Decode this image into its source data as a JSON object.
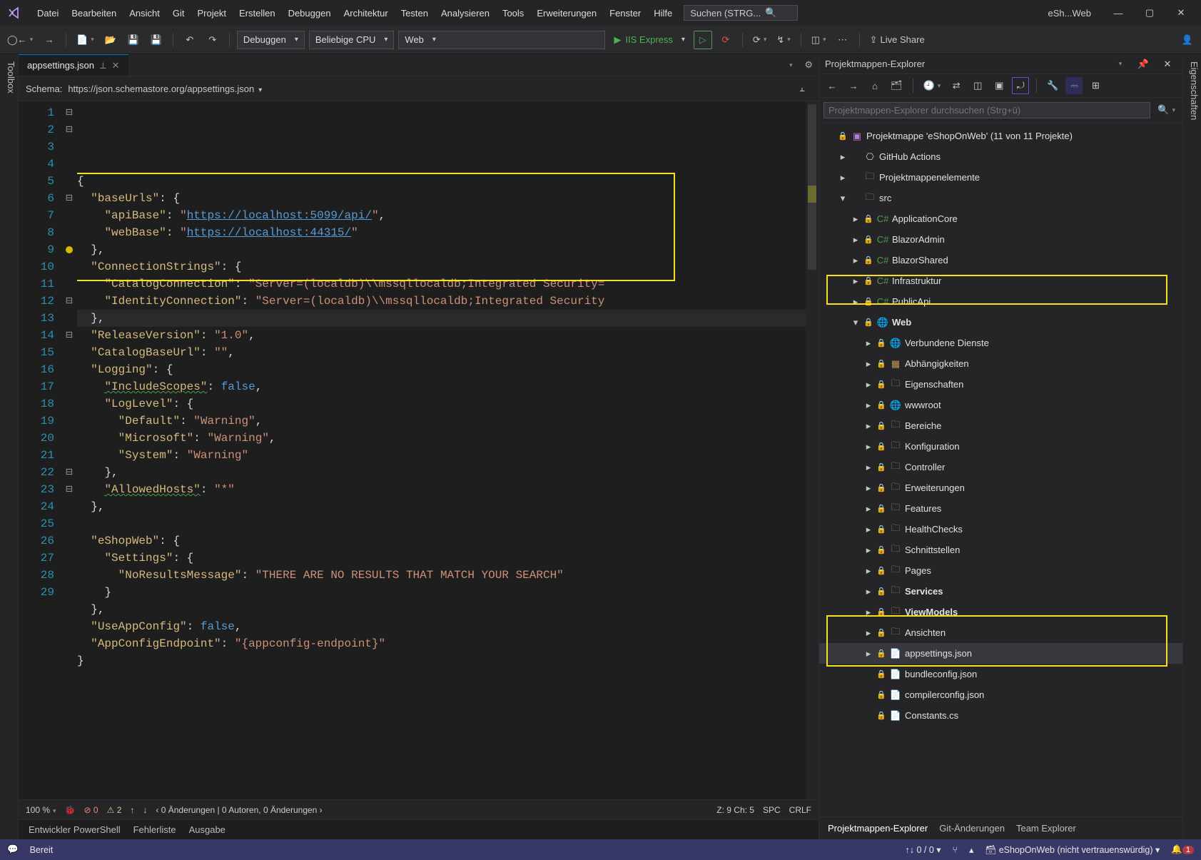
{
  "menu": [
    "Datei",
    "Bearbeiten",
    "Ansicht",
    "Git",
    "Projekt",
    "Erstellen",
    "Debuggen",
    "Architektur",
    "Testen",
    "Analysieren",
    "Tools",
    "Erweiterungen",
    "Fenster",
    "Hilfe"
  ],
  "search": {
    "placeholder": "Suchen (STRG..."
  },
  "app_title": "eSh...Web",
  "toolbar": {
    "config": "Debuggen",
    "platform": "Beliebige CPU",
    "target": "Web",
    "run": "IIS Express",
    "live_share": "Live Share"
  },
  "side_left": "Toolbox",
  "side_right": "Eigenschaften",
  "tab": {
    "name": "appsettings.json"
  },
  "schema": {
    "label": "Schema:",
    "url": "https://json.schemastore.org/appsettings.json"
  },
  "code_lines": [
    {
      "n": 1,
      "txt": "{",
      "fold": "open"
    },
    {
      "n": 2,
      "txt": "  \"baseUrls\": {",
      "fold": "open"
    },
    {
      "n": 3,
      "txt": "    \"apiBase\": \"https://localhost:5099/api/\","
    },
    {
      "n": 4,
      "txt": "    \"webBase\": \"https://localhost:44315/\""
    },
    {
      "n": 5,
      "txt": "  },"
    },
    {
      "n": 6,
      "txt": "  \"ConnectionStrings\": {",
      "fold": "open"
    },
    {
      "n": 7,
      "txt": "    \"CatalogConnection\": \"Server=(localdb)\\\\mssqllocaldb;Integrated Security="
    },
    {
      "n": 8,
      "txt": "    \"IdentityConnection\": \"Server=(localdb)\\\\mssqllocaldb;Integrated Security"
    },
    {
      "n": 9,
      "txt": "  },",
      "cursor": true,
      "marker": true
    },
    {
      "n": 10,
      "txt": "  \"ReleaseVersion\": \"1.0\","
    },
    {
      "n": 11,
      "txt": "  \"CatalogBaseUrl\": \"\","
    },
    {
      "n": 12,
      "txt": "  \"Logging\": {",
      "fold": "open"
    },
    {
      "n": 13,
      "txt": "    \"IncludeScopes\": false,",
      "squiggle": "IncludeScopes"
    },
    {
      "n": 14,
      "txt": "    \"LogLevel\": {",
      "fold": "open"
    },
    {
      "n": 15,
      "txt": "      \"Default\": \"Warning\","
    },
    {
      "n": 16,
      "txt": "      \"Microsoft\": \"Warning\","
    },
    {
      "n": 17,
      "txt": "      \"System\": \"Warning\""
    },
    {
      "n": 18,
      "txt": "    },"
    },
    {
      "n": 19,
      "txt": "    \"AllowedHosts\": \"*\"",
      "squiggle": "AllowedHosts"
    },
    {
      "n": 20,
      "txt": "  },"
    },
    {
      "n": 21,
      "txt": ""
    },
    {
      "n": 22,
      "txt": "  \"eShopWeb\": {",
      "fold": "open"
    },
    {
      "n": 23,
      "txt": "    \"Settings\": {",
      "fold": "open"
    },
    {
      "n": 24,
      "txt": "      \"NoResultsMessage\": \"THERE ARE NO RESULTS THAT MATCH YOUR SEARCH\""
    },
    {
      "n": 25,
      "txt": "    }"
    },
    {
      "n": 26,
      "txt": "  },"
    },
    {
      "n": 27,
      "txt": "  \"UseAppConfig\": false,"
    },
    {
      "n": 28,
      "txt": "  \"AppConfigEndpoint\": \"{appconfig-endpoint}\""
    },
    {
      "n": 29,
      "txt": "}"
    }
  ],
  "editor_status": {
    "zoom": "100 %",
    "errors": "0",
    "warnings": "2",
    "changes": "0 Änderungen | 0 Autoren, 0 Änderungen",
    "pos": "Z: 9  Ch: 5",
    "spc": "SPC",
    "crlf": "CRLF"
  },
  "bottom_tabs": [
    "Entwickler PowerShell",
    "Fehlerliste",
    "Ausgabe"
  ],
  "panel": {
    "title": "Projektmappen-Explorer",
    "search_placeholder": "Projektmappen-Explorer durchsuchen (Strg+ü)",
    "solution": "Projektmappe 'eShopOnWeb' (11 von 11 Projekte)",
    "nodes": {
      "gh": "GitHub Actions",
      "elems": "Projektmappenelemente",
      "src": "src",
      "proj": [
        "ApplicationCore",
        "BlazorAdmin",
        "BlazorShared",
        "Infrastruktur",
        "PublicApi",
        "Web"
      ],
      "web_children": [
        {
          "t": "Verbundene Dienste",
          "icon": "globe"
        },
        {
          "t": "Abhängigkeiten",
          "icon": "pkgs"
        },
        {
          "t": "Eigenschaften",
          "icon": "folder"
        },
        {
          "t": "wwwroot",
          "icon": "globe"
        },
        {
          "t": "Bereiche",
          "icon": "folder"
        },
        {
          "t": "Konfiguration",
          "icon": "folder"
        },
        {
          "t": "Controller",
          "icon": "folder"
        },
        {
          "t": "Erweiterungen",
          "icon": "folder"
        },
        {
          "t": "Features",
          "icon": "folder"
        },
        {
          "t": "HealthChecks",
          "icon": "folder"
        },
        {
          "t": "Schnittstellen",
          "icon": "folder"
        },
        {
          "t": "Pages",
          "icon": "folder"
        },
        {
          "t": "Services",
          "icon": "folder",
          "bold": true
        },
        {
          "t": "ViewModels",
          "icon": "folder",
          "bold": true
        },
        {
          "t": "Ansichten",
          "icon": "folder"
        }
      ],
      "web_files": [
        "appsettings.json",
        "bundleconfig.json",
        "compilerconfig.json",
        "Constants.cs"
      ]
    },
    "footer_tabs": [
      "Projektmappen-Explorer",
      "Git-Änderungen",
      "Team Explorer"
    ]
  },
  "statusbar": {
    "ready": "Bereit",
    "nav": "0 / 0",
    "repo": "eShopOnWeb (nicht vertrauenswürdig)",
    "bell_count": "1"
  }
}
